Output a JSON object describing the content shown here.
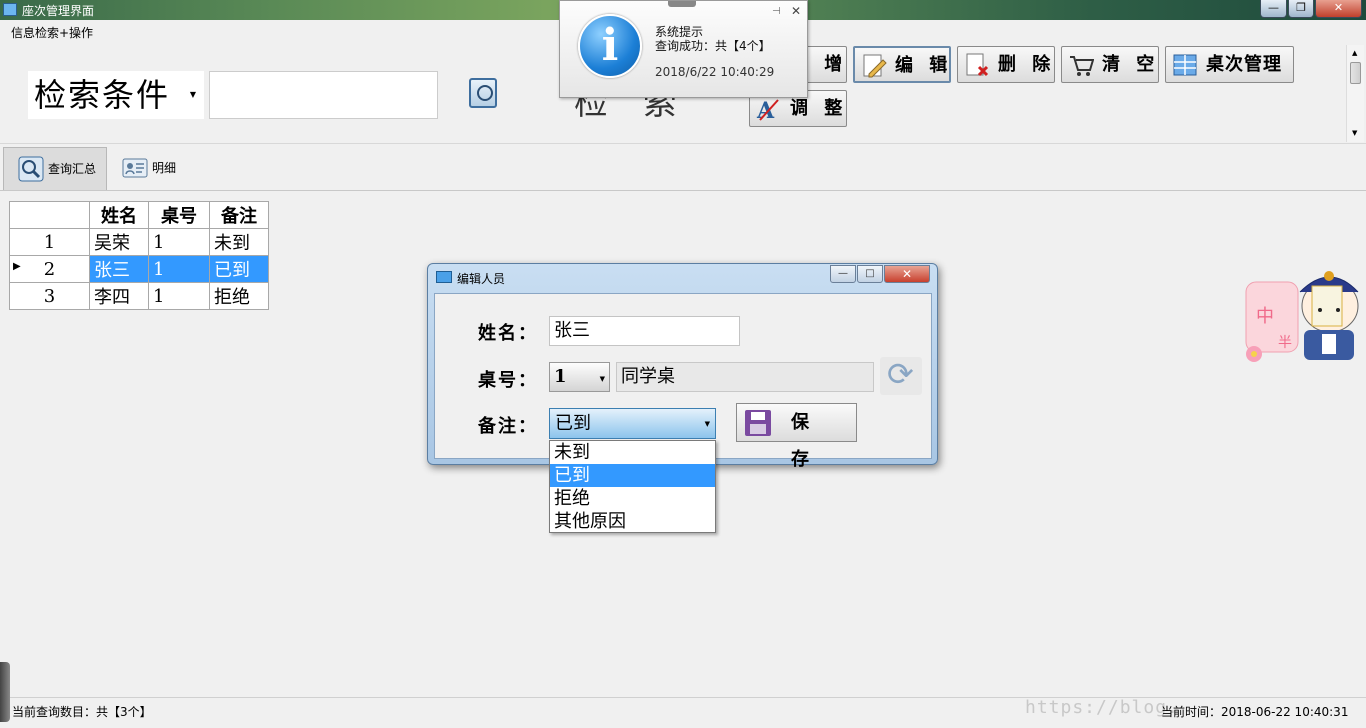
{
  "window": {
    "title": "座次管理界面",
    "buttons": {
      "minimize": "—",
      "maximize": "❐",
      "close": "✕"
    }
  },
  "menu": {
    "item": "信息检索+操作"
  },
  "search": {
    "condition_label": "检索条件",
    "input_value": "",
    "search_label": "检 索"
  },
  "toolbar": {
    "add": "新 增",
    "edit": "编 辑",
    "delete": "删 除",
    "clear": "清 空",
    "table_manage": "桌次管理",
    "adjust": "调 整"
  },
  "tabs": {
    "summary": "查询汇总",
    "detail": "明细"
  },
  "grid": {
    "headers": [
      "姓名",
      "桌号",
      "备注"
    ],
    "rows": [
      {
        "index": "1",
        "name": "吴荣",
        "table": "1",
        "remark": "未到"
      },
      {
        "index": "2",
        "name": "张三",
        "table": "1",
        "remark": "已到"
      },
      {
        "index": "3",
        "name": "李四",
        "table": "1",
        "remark": "拒绝"
      }
    ],
    "selected_row": "2"
  },
  "notification": {
    "title": "系统提示",
    "message": "查询成功：共【4个】",
    "datetime": "2018/6/22 10:40:29",
    "icon": "info-icon"
  },
  "dialog": {
    "title": "编辑人员",
    "name_label": "姓名：",
    "name_value": "张三",
    "table_label": "桌号：",
    "table_value": "1",
    "table_name": "同学桌",
    "remark_label": "备注：",
    "remark_value": "已到",
    "save_label": "保 存",
    "remark_options": [
      "未到",
      "已到",
      "拒绝",
      "其他原因"
    ],
    "selected_option": "已到"
  },
  "status": {
    "count_text": "当前查询数目：共【3个】",
    "time_text": "当前时间：2018-06-22 10:40:31",
    "watermark": "https://blog."
  },
  "colors": {
    "selection": "#3399ff",
    "dialog_frame": "#a8c6e4"
  }
}
